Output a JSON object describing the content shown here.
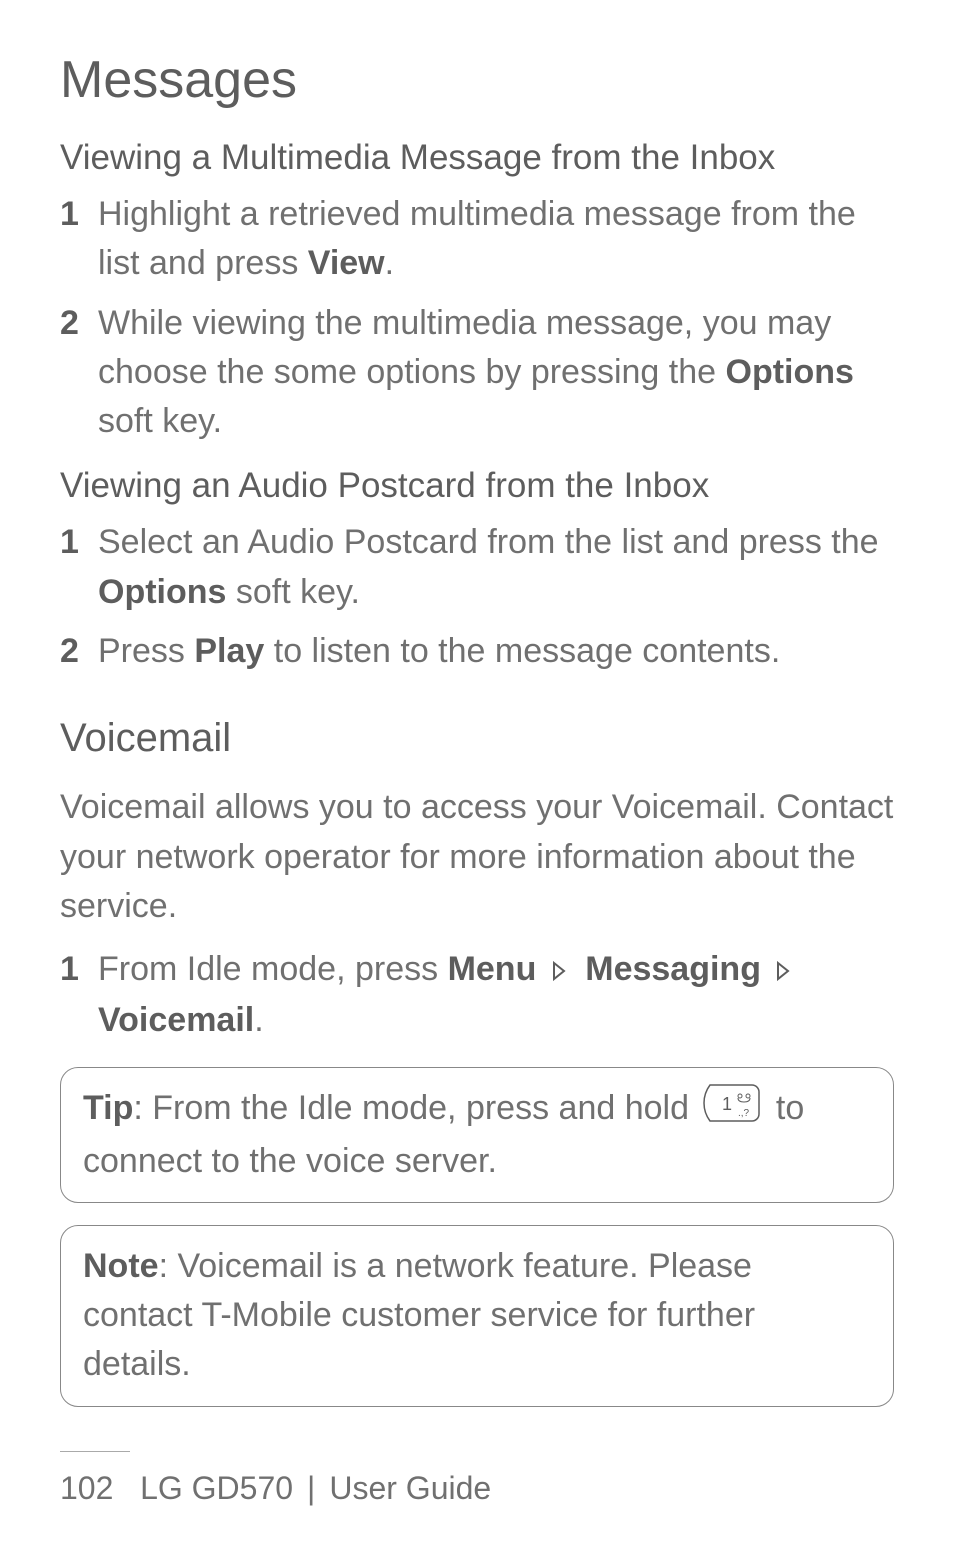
{
  "page_title": "Messages",
  "section1": {
    "heading": "Viewing a Multimedia Message from the Inbox",
    "items": [
      {
        "num": "1",
        "pre": "Highlight a retrieved multimedia message from the list and press ",
        "bold": "View",
        "post": "."
      },
      {
        "num": "2",
        "pre": "While viewing the multimedia message, you may choose the some options by pressing the ",
        "bold": "Options",
        "post": " soft key."
      }
    ]
  },
  "section2": {
    "heading": "Viewing an Audio Postcard from the Inbox",
    "items": [
      {
        "num": "1",
        "pre": "Select an Audio Postcard from the list and press the ",
        "bold": "Options",
        "post": " soft key."
      },
      {
        "num": "2",
        "pre": "Press ",
        "bold": "Play",
        "post": " to listen to the message contents."
      }
    ]
  },
  "section3": {
    "heading": "Voicemail",
    "para": "Voicemail allows you to access your Voicemail. Contact your network operator for more information about the service.",
    "item": {
      "num": "1",
      "pre": "From Idle mode, press ",
      "bold1": "Menu",
      "bold2": "Messaging",
      "bold3": "Voicemail",
      "post": "."
    }
  },
  "tipbox": {
    "label": "Tip",
    "pre": ": From the Idle mode, press and hold ",
    "post": " to connect to the voice server."
  },
  "notebox": {
    "label": "Note",
    "text": ": Voicemail is a network feature. Please contact T-Mobile customer service for further details."
  },
  "footer": {
    "page_num": "102",
    "product": "LG GD570",
    "guide": "User Guide"
  }
}
